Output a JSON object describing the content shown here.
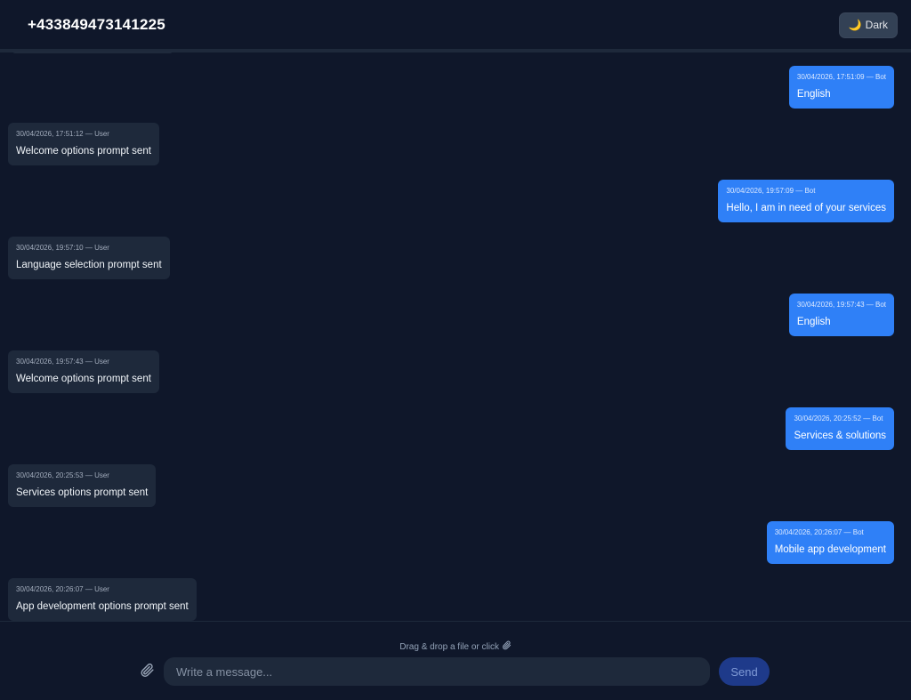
{
  "header": {
    "title": "+433849473141225",
    "theme_icon": "moon-icon",
    "theme_label": "Dark"
  },
  "messages": [
    {
      "side": "bot",
      "meta": "30/04/2026, 17:51:09 — Bot",
      "text": "English"
    },
    {
      "side": "user",
      "meta": "30/04/2026, 17:51:12 — User",
      "text": "Welcome options prompt sent"
    },
    {
      "side": "bot",
      "meta": "30/04/2026, 19:57:09 — Bot",
      "text": "Hello, I am in need of your services"
    },
    {
      "side": "user",
      "meta": "30/04/2026, 19:57:10 — User",
      "text": "Language selection prompt sent"
    },
    {
      "side": "bot",
      "meta": "30/04/2026, 19:57:43 — Bot",
      "text": "English"
    },
    {
      "side": "user",
      "meta": "30/04/2026, 19:57:43 — User",
      "text": "Welcome options prompt sent"
    },
    {
      "side": "bot",
      "meta": "30/04/2026, 20:25:52 — Bot",
      "text": "Services & solutions"
    },
    {
      "side": "user",
      "meta": "30/04/2026, 20:25:53 — User",
      "text": "Services options prompt sent"
    },
    {
      "side": "bot",
      "meta": "30/04/2026, 20:26:07 — Bot",
      "text": "Mobile app development"
    },
    {
      "side": "user",
      "meta": "30/04/2026, 20:26:07 — User",
      "text": "App development options prompt sent"
    }
  ],
  "composer": {
    "dropzone_text": "Drag & drop a file or click",
    "dropzone_icon": "paperclip-icon",
    "attach_icon": "paperclip-icon",
    "input_value": "",
    "input_placeholder": "Write a message...",
    "send_label": "Send"
  },
  "colors": {
    "background": "#0f172a",
    "user_bubble": "#1e293b",
    "bot_bubble": "#2f80f7",
    "send_button": "#1e3a8a"
  }
}
